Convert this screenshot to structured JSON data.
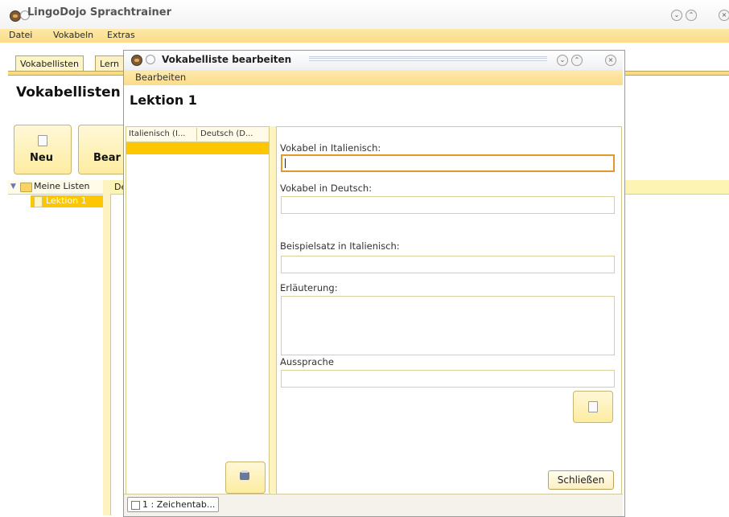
{
  "main_window": {
    "title": "LingoDojo Sprachtrainer",
    "menu": [
      "Datei",
      "Vokabeln",
      "Extras"
    ],
    "tabs": [
      "Vokabellisten",
      "Lern"
    ],
    "page_title": "Vokabellisten",
    "buttons": {
      "new": "Neu",
      "edit": "Bear"
    },
    "tree": {
      "root": "Meine Listen",
      "child": "Lektion 1"
    },
    "column_header_partial": "De"
  },
  "dialog": {
    "title": "Vokabelliste bearbeiten",
    "menu": [
      "Bearbeiten"
    ],
    "heading": "Lektion 1",
    "list_columns": [
      "Italienisch (I...",
      "Deutsch (D..."
    ],
    "fields": {
      "vokabel_it_label": "Vokabel in Italienisch:",
      "vokabel_it_value": "",
      "vokabel_de_label": "Vokabel in Deutsch:",
      "vokabel_de_value": "",
      "beispiel_label": "Beispielsatz in Italienisch:",
      "beispiel_value": "",
      "erlaeuterung_label": "Erläuterung:",
      "erlaeuterung_value": "",
      "aussprache_label": "Aussprache",
      "aussprache_value": ""
    },
    "close_label": "Schließen",
    "status_item": "1 : Zeichentab..."
  },
  "colors": {
    "accent_yellow": "#fcc700",
    "menubar": "#fcdc88",
    "focus_border": "#e19a28"
  }
}
